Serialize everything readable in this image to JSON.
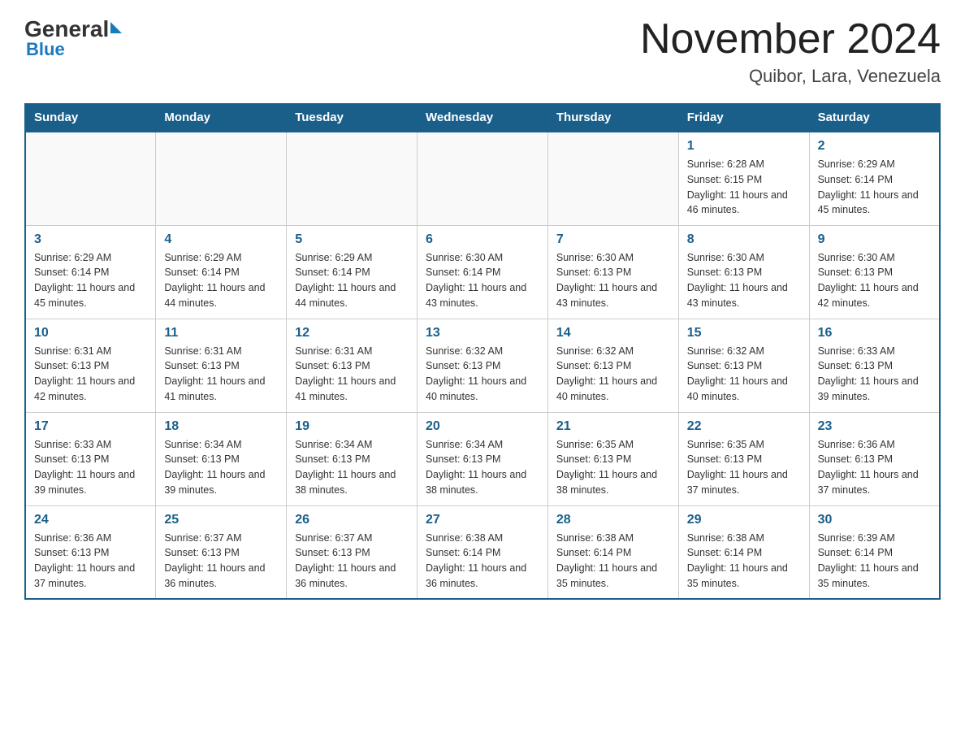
{
  "header": {
    "logo_general": "General",
    "logo_blue": "Blue",
    "title": "November 2024",
    "subtitle": "Quibor, Lara, Venezuela"
  },
  "days": [
    "Sunday",
    "Monday",
    "Tuesday",
    "Wednesday",
    "Thursday",
    "Friday",
    "Saturday"
  ],
  "weeks": [
    [
      {
        "day": "",
        "info": ""
      },
      {
        "day": "",
        "info": ""
      },
      {
        "day": "",
        "info": ""
      },
      {
        "day": "",
        "info": ""
      },
      {
        "day": "",
        "info": ""
      },
      {
        "day": "1",
        "info": "Sunrise: 6:28 AM\nSunset: 6:15 PM\nDaylight: 11 hours and 46 minutes."
      },
      {
        "day": "2",
        "info": "Sunrise: 6:29 AM\nSunset: 6:14 PM\nDaylight: 11 hours and 45 minutes."
      }
    ],
    [
      {
        "day": "3",
        "info": "Sunrise: 6:29 AM\nSunset: 6:14 PM\nDaylight: 11 hours and 45 minutes."
      },
      {
        "day": "4",
        "info": "Sunrise: 6:29 AM\nSunset: 6:14 PM\nDaylight: 11 hours and 44 minutes."
      },
      {
        "day": "5",
        "info": "Sunrise: 6:29 AM\nSunset: 6:14 PM\nDaylight: 11 hours and 44 minutes."
      },
      {
        "day": "6",
        "info": "Sunrise: 6:30 AM\nSunset: 6:14 PM\nDaylight: 11 hours and 43 minutes."
      },
      {
        "day": "7",
        "info": "Sunrise: 6:30 AM\nSunset: 6:13 PM\nDaylight: 11 hours and 43 minutes."
      },
      {
        "day": "8",
        "info": "Sunrise: 6:30 AM\nSunset: 6:13 PM\nDaylight: 11 hours and 43 minutes."
      },
      {
        "day": "9",
        "info": "Sunrise: 6:30 AM\nSunset: 6:13 PM\nDaylight: 11 hours and 42 minutes."
      }
    ],
    [
      {
        "day": "10",
        "info": "Sunrise: 6:31 AM\nSunset: 6:13 PM\nDaylight: 11 hours and 42 minutes."
      },
      {
        "day": "11",
        "info": "Sunrise: 6:31 AM\nSunset: 6:13 PM\nDaylight: 11 hours and 41 minutes."
      },
      {
        "day": "12",
        "info": "Sunrise: 6:31 AM\nSunset: 6:13 PM\nDaylight: 11 hours and 41 minutes."
      },
      {
        "day": "13",
        "info": "Sunrise: 6:32 AM\nSunset: 6:13 PM\nDaylight: 11 hours and 40 minutes."
      },
      {
        "day": "14",
        "info": "Sunrise: 6:32 AM\nSunset: 6:13 PM\nDaylight: 11 hours and 40 minutes."
      },
      {
        "day": "15",
        "info": "Sunrise: 6:32 AM\nSunset: 6:13 PM\nDaylight: 11 hours and 40 minutes."
      },
      {
        "day": "16",
        "info": "Sunrise: 6:33 AM\nSunset: 6:13 PM\nDaylight: 11 hours and 39 minutes."
      }
    ],
    [
      {
        "day": "17",
        "info": "Sunrise: 6:33 AM\nSunset: 6:13 PM\nDaylight: 11 hours and 39 minutes."
      },
      {
        "day": "18",
        "info": "Sunrise: 6:34 AM\nSunset: 6:13 PM\nDaylight: 11 hours and 39 minutes."
      },
      {
        "day": "19",
        "info": "Sunrise: 6:34 AM\nSunset: 6:13 PM\nDaylight: 11 hours and 38 minutes."
      },
      {
        "day": "20",
        "info": "Sunrise: 6:34 AM\nSunset: 6:13 PM\nDaylight: 11 hours and 38 minutes."
      },
      {
        "day": "21",
        "info": "Sunrise: 6:35 AM\nSunset: 6:13 PM\nDaylight: 11 hours and 38 minutes."
      },
      {
        "day": "22",
        "info": "Sunrise: 6:35 AM\nSunset: 6:13 PM\nDaylight: 11 hours and 37 minutes."
      },
      {
        "day": "23",
        "info": "Sunrise: 6:36 AM\nSunset: 6:13 PM\nDaylight: 11 hours and 37 minutes."
      }
    ],
    [
      {
        "day": "24",
        "info": "Sunrise: 6:36 AM\nSunset: 6:13 PM\nDaylight: 11 hours and 37 minutes."
      },
      {
        "day": "25",
        "info": "Sunrise: 6:37 AM\nSunset: 6:13 PM\nDaylight: 11 hours and 36 minutes."
      },
      {
        "day": "26",
        "info": "Sunrise: 6:37 AM\nSunset: 6:13 PM\nDaylight: 11 hours and 36 minutes."
      },
      {
        "day": "27",
        "info": "Sunrise: 6:38 AM\nSunset: 6:14 PM\nDaylight: 11 hours and 36 minutes."
      },
      {
        "day": "28",
        "info": "Sunrise: 6:38 AM\nSunset: 6:14 PM\nDaylight: 11 hours and 35 minutes."
      },
      {
        "day": "29",
        "info": "Sunrise: 6:38 AM\nSunset: 6:14 PM\nDaylight: 11 hours and 35 minutes."
      },
      {
        "day": "30",
        "info": "Sunrise: 6:39 AM\nSunset: 6:14 PM\nDaylight: 11 hours and 35 minutes."
      }
    ]
  ]
}
